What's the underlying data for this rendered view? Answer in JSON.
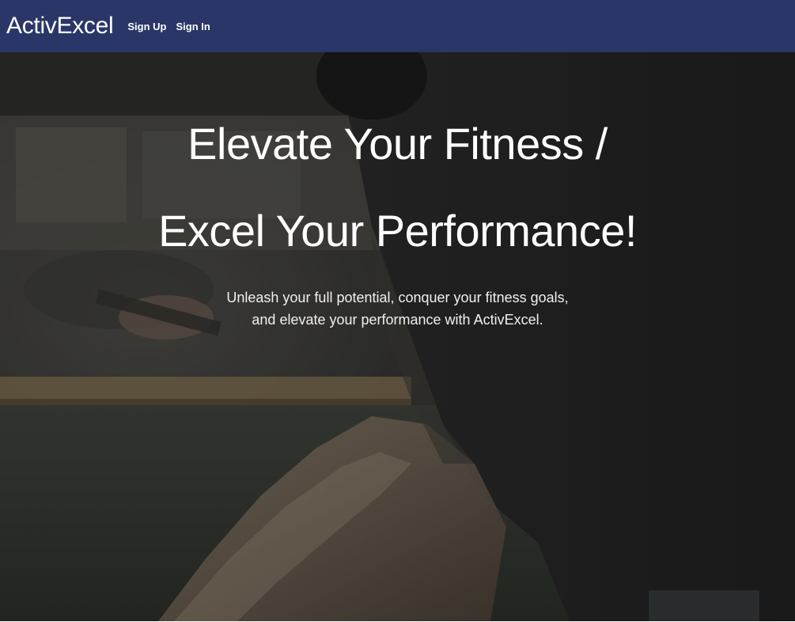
{
  "navbar": {
    "brand": "ActivExcel",
    "links": [
      {
        "label": "Sign Up"
      },
      {
        "label": "Sign In"
      }
    ],
    "background_color": "#2b3668"
  },
  "hero": {
    "title_line_1": "Elevate Your Fitness /",
    "title_line_2": "Excel Your Performance!",
    "subtitle_line_1": "Unleash your full potential, conquer your fitness goals,",
    "subtitle_line_2": "and elevate your performance with ActivExcel.",
    "background_image": "dark gym photo of person exercising on rowing machine"
  }
}
